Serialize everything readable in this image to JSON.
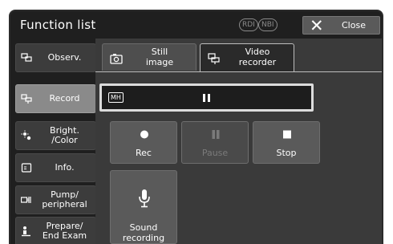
{
  "window": {
    "title": "Function list",
    "close_label": "Close",
    "mode_badges": [
      "RDI",
      "NBI"
    ]
  },
  "sidebar": {
    "items": [
      {
        "label": "Observ.",
        "icon": "observation-icon",
        "active": false
      },
      {
        "label": "Record",
        "icon": "record-icon",
        "active": true
      },
      {
        "label": "Bright.\n/Color",
        "icon": "brightness-icon",
        "active": false
      },
      {
        "label": "Info.",
        "icon": "info-icon",
        "active": false
      },
      {
        "label": "Pump/\nperipheral",
        "icon": "pump-icon",
        "active": false
      },
      {
        "label": "Prepare/\nEnd Exam",
        "icon": "prepare-icon",
        "active": false
      }
    ]
  },
  "tabs": [
    {
      "label": "Still\nimage",
      "icon": "camera-icon",
      "active": false
    },
    {
      "label": "Video\nrecorder",
      "icon": "video-recorder-icon",
      "active": true
    }
  ],
  "status": {
    "media_label": "MH",
    "state_icon": "pause-indicator-icon"
  },
  "controls": [
    {
      "label": "Rec",
      "icon": "record-dot-icon",
      "enabled": true
    },
    {
      "label": "Pause",
      "icon": "pause-icon",
      "enabled": false
    },
    {
      "label": "Stop",
      "icon": "stop-icon",
      "enabled": true
    }
  ],
  "sound": {
    "label": "Sound\nrecording",
    "icon": "microphone-icon"
  }
}
